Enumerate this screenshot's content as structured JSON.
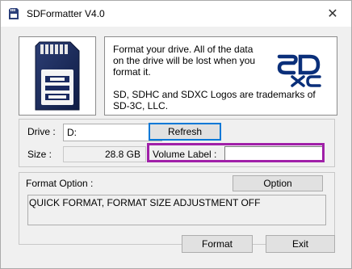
{
  "window": {
    "title": "SDFormatter V4.0",
    "close_glyph": "✕"
  },
  "info": {
    "warning_text": "Format your drive. All of the data\non the drive will be lost when you\nformat it.",
    "trademark_text": "SD, SDHC and SDXC Logos are trademarks of\nSD-3C, LLC."
  },
  "icons": {
    "app": "sd-card-icon",
    "sd_card_image": "sdhc-card-icon",
    "sdxc_logo": "sdxc-logo-icon",
    "dropdown": "chevron-down-icon"
  },
  "drive": {
    "label": "Drive :",
    "selected": "D:",
    "refresh_label": "Refresh",
    "size_label": "Size  :",
    "size_value": "28.8  GB",
    "volume_label": "Volume Label  :",
    "volume_value": ""
  },
  "format_option": {
    "group_label": "Format Option :",
    "option_button": "Option",
    "current": "QUICK FORMAT, FORMAT SIZE ADJUSTMENT OFF"
  },
  "actions": {
    "format_label": "Format",
    "exit_label": "Exit"
  },
  "colors": {
    "highlight": "#a020a8",
    "focus": "#0078d7",
    "logo_blue": "#0a2f7a"
  }
}
